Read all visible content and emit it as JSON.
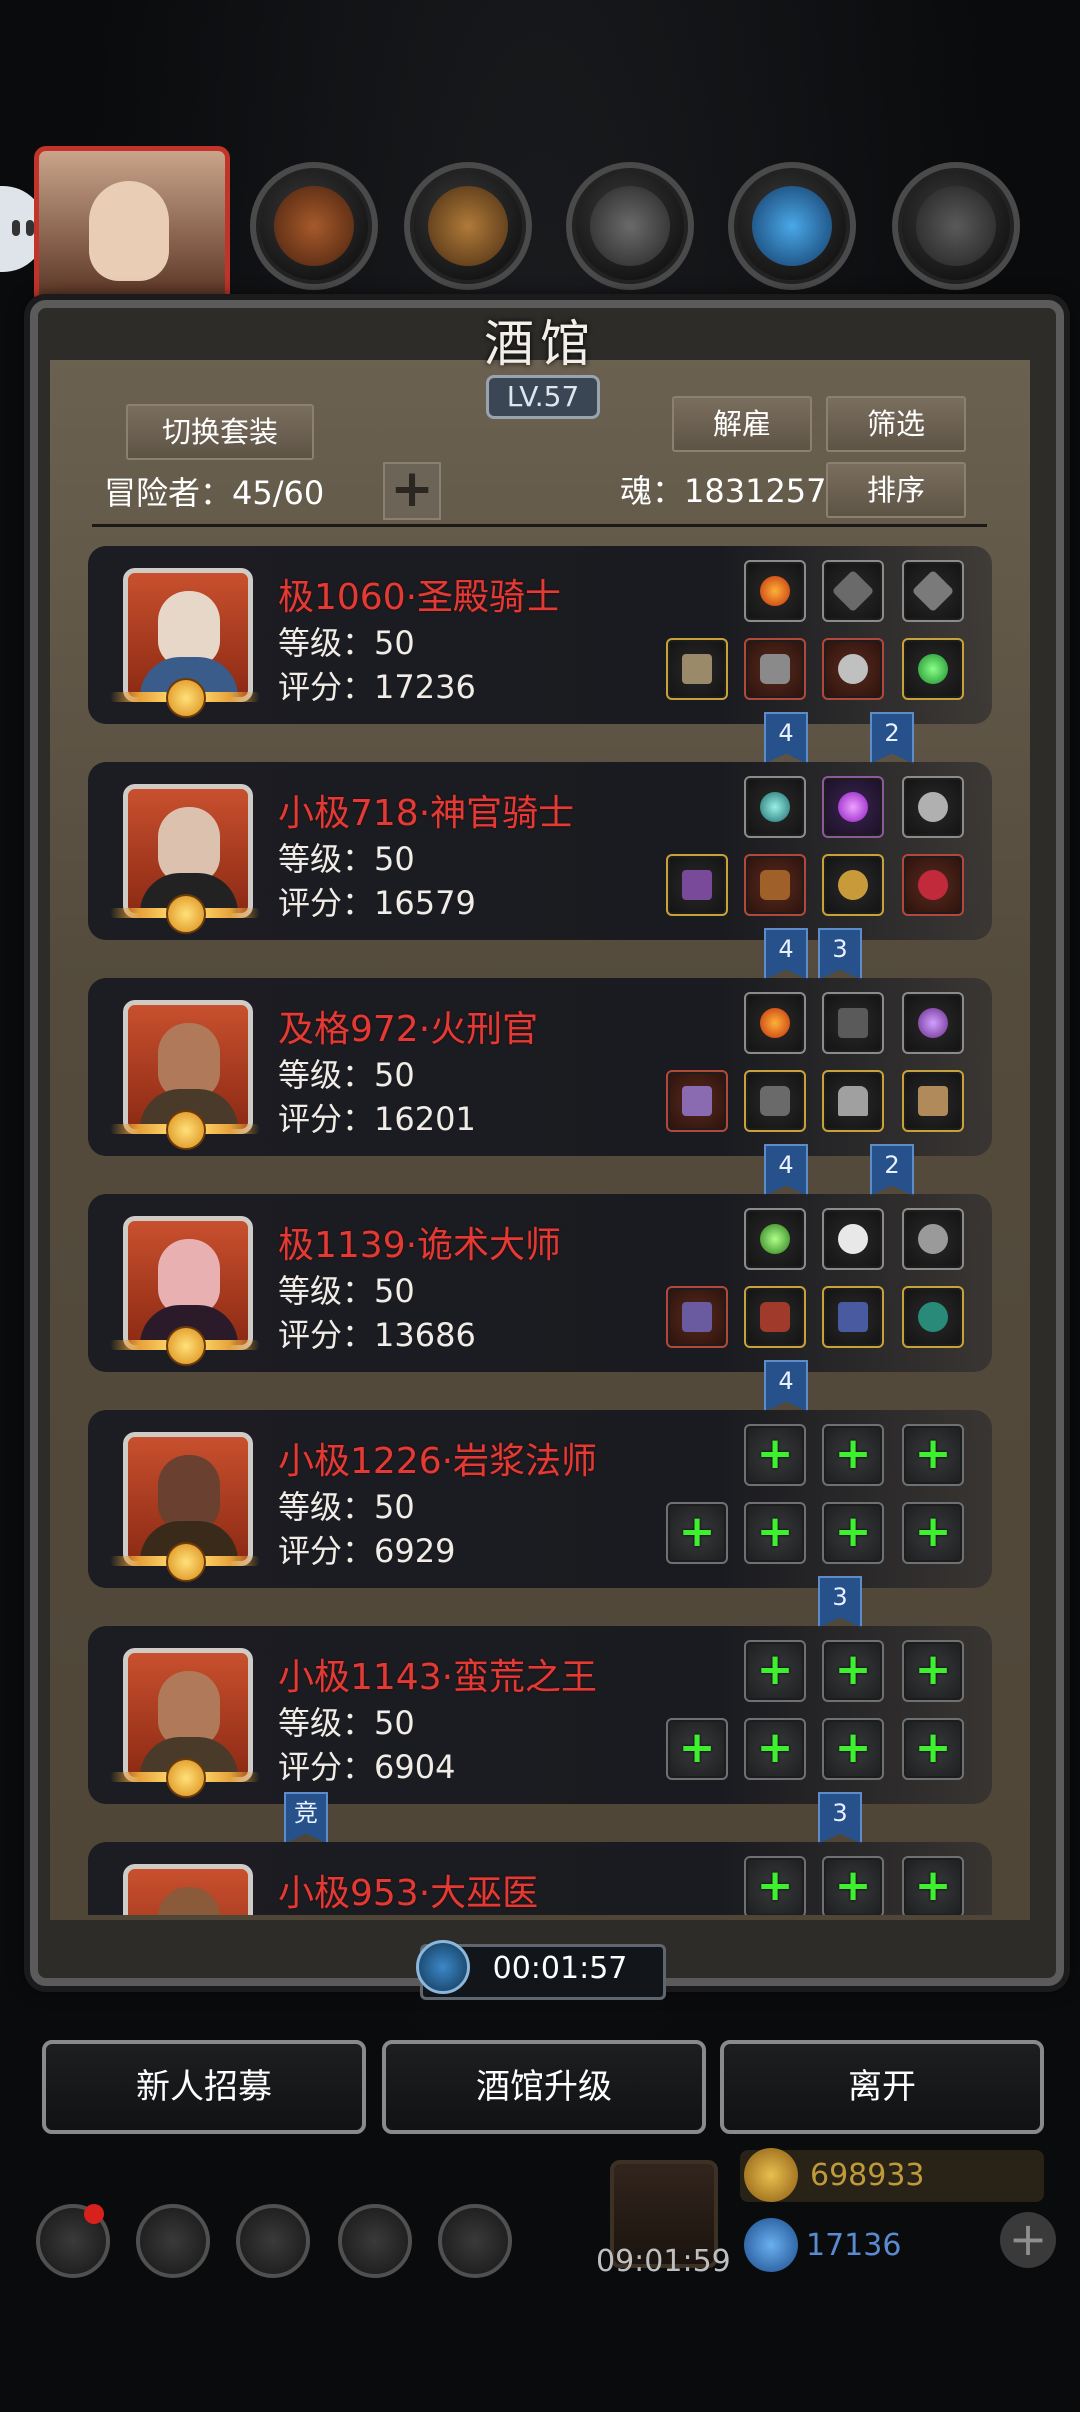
{
  "tavern": {
    "title": "酒馆",
    "level": "LV.57"
  },
  "buttons": {
    "switch_outfit": "切换套装",
    "dismiss": "解雇",
    "filter": "筛选",
    "sort": "排序"
  },
  "adventurers": {
    "label": "冒险者：45/60"
  },
  "soul": {
    "label": "魂：1831257"
  },
  "heroes": [
    {
      "name": "极1060·圣殿骑士",
      "level": "等级：50",
      "score": "评分：17236",
      "flags": [
        "4",
        "2"
      ]
    },
    {
      "name": "小极718·神官骑士",
      "level": "等级：50",
      "score": "评分：16579",
      "flags": [
        "4",
        "3"
      ]
    },
    {
      "name": "及格972·火刑官",
      "level": "等级：50",
      "score": "评分：16201",
      "flags": [
        "4",
        "2"
      ]
    },
    {
      "name": "极1139·诡术大师",
      "level": "等级：50",
      "score": "评分：13686",
      "flags": [
        "4"
      ]
    },
    {
      "name": "小极1226·岩浆法师",
      "level": "等级：50",
      "score": "评分：6929",
      "flags": [
        "3"
      ]
    },
    {
      "name": "小极1143·蛮荒之王",
      "level": "等级：50",
      "score": "评分：6904",
      "flags": [
        "竞",
        "3"
      ]
    },
    {
      "name": "小极953·大巫医",
      "level": "",
      "score": "",
      "flags": []
    }
  ],
  "timer": "00:01:57",
  "bottom_buttons": {
    "recruit": "新人招募",
    "upgrade": "酒馆升级",
    "leave": "离开"
  },
  "footer": {
    "gift_timer": "09:01:59",
    "gold": "698933",
    "diamond": "17136"
  },
  "colors": {
    "hero_name": "#e23b36",
    "plus": "#3ef02f",
    "flag": "#27518b"
  }
}
